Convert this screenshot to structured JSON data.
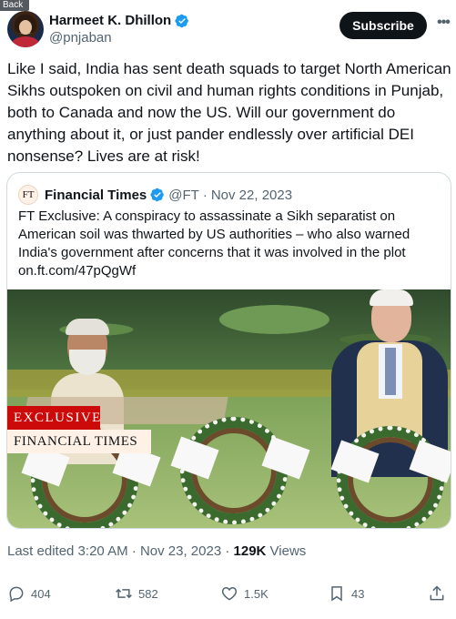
{
  "nav": {
    "back_label": "Back"
  },
  "author": {
    "name": "Harmeet K. Dhillon",
    "handle": "@pnjaban",
    "verified": true,
    "verified_color": "#1d9bf0"
  },
  "subscribe_label": "Subscribe",
  "tweet_text": "Like I said, India has sent death squads to target North American Sikhs outspoken on civil and human rights conditions in Punjab, both to Canada and now the US. Will our government do anything about it, or just pander endlessly over artificial DEI nonsense? Lives are at risk!",
  "quote": {
    "logo_text": "FT",
    "name": "Financial Times",
    "handle": "@FT",
    "date": "Nov 22, 2023",
    "text": "FT Exclusive: A conspiracy to assassinate a Sikh separatist on American soil was thwarted by US authorities – who also warned India's government after concerns that it was involved in the plot",
    "link": "on.ft.com/47pQgWf",
    "image_badges": {
      "exclusive": "EXCLUSIVE",
      "brand": "FINANCIAL TIMES"
    },
    "badge_color": "#cc0a0a"
  },
  "meta": {
    "edited": "Last edited 3:20 AM",
    "date": "Nov 23, 2023",
    "views_count": "129K",
    "views_label": "Views"
  },
  "actions": {
    "replies": "404",
    "reposts": "582",
    "likes": "1.5K",
    "bookmarks": "43"
  },
  "colors": {
    "text": "#0f1419",
    "secondary": "#536471",
    "border": "#cfd9de"
  }
}
